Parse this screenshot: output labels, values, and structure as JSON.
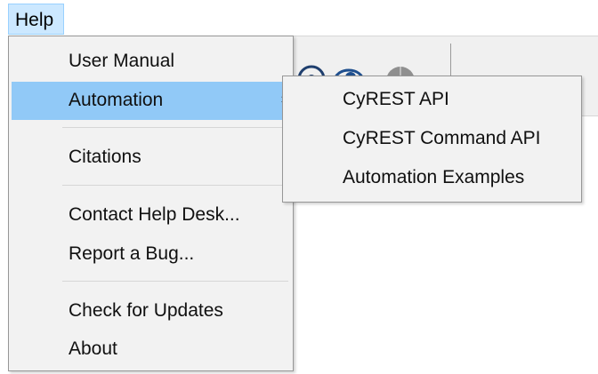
{
  "menubar": {
    "help_label": "Help"
  },
  "help_menu": {
    "items": [
      {
        "label": "User Manual"
      },
      {
        "label": "Automation",
        "submenu_arrow": "›"
      },
      {
        "label": "Citations"
      },
      {
        "label": "Contact Help Desk..."
      },
      {
        "label": "Report a Bug..."
      },
      {
        "label": "Check for Updates"
      },
      {
        "label": "About"
      }
    ]
  },
  "automation_submenu": {
    "items": [
      {
        "label": "CyREST API"
      },
      {
        "label": "CyREST Command API"
      },
      {
        "label": "Automation Examples"
      }
    ]
  },
  "colors": {
    "menu_bg": "#f2f2f2",
    "highlight": "#91c9f7",
    "header_highlight": "#cce8ff"
  }
}
